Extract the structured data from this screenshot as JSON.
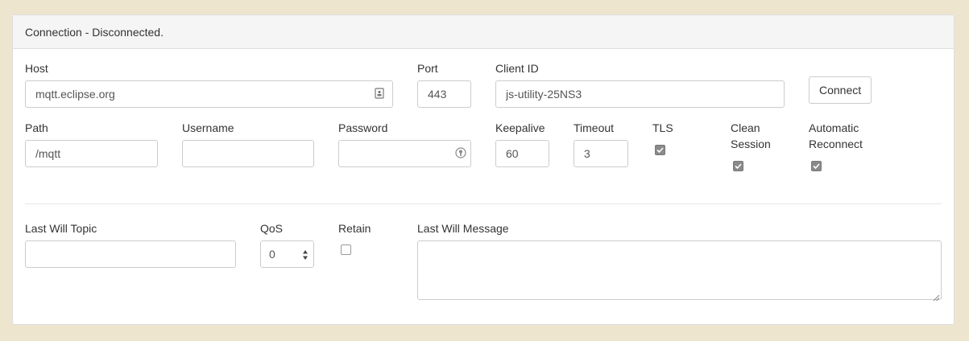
{
  "header": {
    "title": "Connection - Disconnected."
  },
  "connection": {
    "host_label": "Host",
    "host_value": "mqtt.eclipse.org",
    "port_label": "Port",
    "port_value": "443",
    "client_id_label": "Client ID",
    "client_id_value": "js-utility-25NS3",
    "connect_label": "Connect",
    "path_label": "Path",
    "path_value": "/mqtt",
    "username_label": "Username",
    "username_value": "",
    "password_label": "Password",
    "password_value": "",
    "keepalive_label": "Keepalive",
    "keepalive_value": "60",
    "timeout_label": "Timeout",
    "timeout_value": "3",
    "tls_label": "TLS",
    "tls_checked": true,
    "clean_session_label_1": "Clean",
    "clean_session_label_2": "Session",
    "clean_session_checked": true,
    "auto_reconnect_label_1": "Automatic",
    "auto_reconnect_label_2": "Reconnect",
    "auto_reconnect_checked": true
  },
  "last_will": {
    "topic_label": "Last Will Topic",
    "topic_value": "",
    "qos_label": "QoS",
    "qos_value": "0",
    "retain_label": "Retain",
    "retain_checked": false,
    "message_label": "Last Will Message",
    "message_value": ""
  },
  "colors": {
    "page_background": "#eee5cf",
    "panel_heading": "#f5f5f5",
    "checkbox_checked": "#8a8a8a"
  },
  "icons": {
    "host_field": "contact-card-icon",
    "password_field": "key-icon",
    "qos_select": "up-down-arrows-icon"
  }
}
